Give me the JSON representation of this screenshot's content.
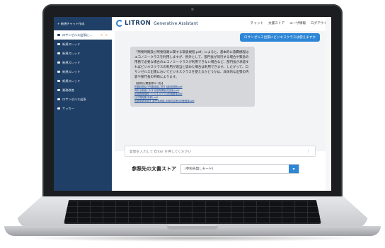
{
  "sidebar": {
    "new_chat_label": "+ 新規チャット作成",
    "items": [
      {
        "label": "ロサンゼルス出張に…",
        "active": true,
        "actions": "✎ ✕"
      },
      {
        "label": "新規スレッド"
      },
      {
        "label": "新規スレッド"
      },
      {
        "label": "新規スレッド"
      },
      {
        "label": "新規スレッド"
      },
      {
        "label": "新規スレッド"
      },
      {
        "label": "業務改善"
      },
      {
        "label": "ロサンゼルス出張"
      },
      {
        "label": "サッカー"
      }
    ]
  },
  "header": {
    "brand": "LITRON",
    "subtitle": "Generative Assistant",
    "nav": [
      "チャット",
      "文書ストア",
      "ユーザ情報",
      "ログアウト"
    ]
  },
  "chat": {
    "user_message": "ロサンゼルス出張にビジネスクラスは使えますか",
    "bot_message": "「所要時間及び所要経路に関する取扱規程.pdf」によると、基本的に旅費規程はエコノミークラスを利用しますが、例外として、部門長が同行する場合や緊急の用務で必要な場合のエコノミークラスが利用できない場合など、部門長が承認すればビジネスクラスの利用が適当と認めた場合は利用できます。したがって、ロサンゼルス出張においてビジネスクラスを使えるかどうかは、具体的な出張の内容や部門長の判断によります。",
    "references_heading": "【参照元(関連資料一覧)】",
    "references": [
      "所要時間及び所要経路に関する取扱規程.pdf",
      "海外出張者に対する旅費規程(改定版).pdf",
      "出張旅費規程・ビジネスクラス利用基準.pdf",
      "社内規程集(旅費).pdf",
      "出張申請手続き_部門長承認_利用可否等の判断基準.pdf"
    ]
  },
  "input": {
    "placeholder": "質問を入力して Enter を押してください"
  },
  "doc_store": {
    "label": "参照先の文書ストア",
    "value": "(参照先無しモード)"
  },
  "colors": {
    "sidebar_bg": "#1f3f66",
    "accent_blue": "#2d86d6",
    "bot_bubble": "#d5d7db"
  }
}
